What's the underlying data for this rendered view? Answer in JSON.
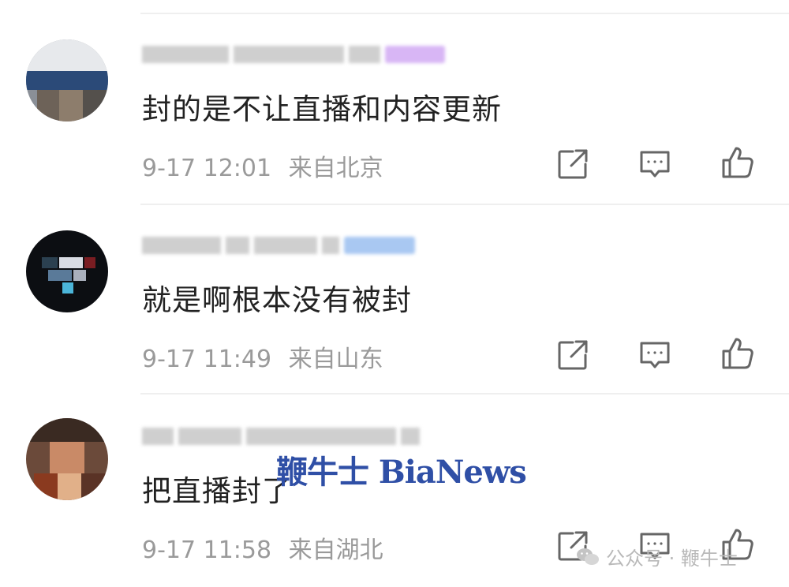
{
  "comments": [
    {
      "text": "封的是不让直播和内容更新",
      "time": "9-17 12:01",
      "location": "来自北京",
      "badge_color": "#d8b6f5"
    },
    {
      "text": "就是啊根本没有被封",
      "time": "9-17 11:49",
      "location": "来自山东",
      "badge_color": "#a9c8f2"
    },
    {
      "text": "把直播封了",
      "time": "9-17 11:58",
      "location": "来自湖北",
      "badge_color": ""
    }
  ],
  "actions": {
    "share_icon": "share-icon",
    "reply_icon": "comment-icon",
    "like_icon": "thumbs-up-icon"
  },
  "watermark": {
    "text": "鞭牛士 BiaNews",
    "color": "#2f4fa6"
  },
  "footer": {
    "text": "公众号 · 鞭牛士"
  }
}
